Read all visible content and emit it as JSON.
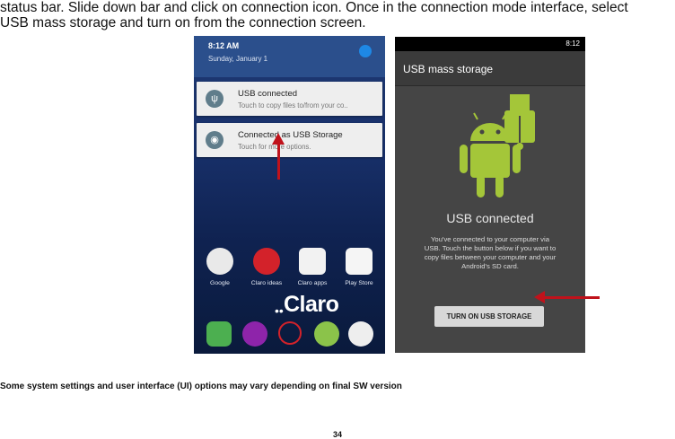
{
  "instructions": {
    "line1": "status bar. Slide down bar and click on connection icon. Once in the connection mode interface, select",
    "line2": "USB mass storage and turn on from the connection screen."
  },
  "left_screen": {
    "time": "8:12 AM",
    "date": "Sunday, January 1",
    "notifications": [
      {
        "title": "USB connected",
        "subtitle": "Touch to copy files to/from your co..",
        "icon": "usb-icon"
      },
      {
        "title": "Connected as USB Storage",
        "subtitle": "Touch for more options.",
        "icon": "android-icon"
      }
    ],
    "apps": [
      "Google",
      "Claro ideas",
      "Claro apps",
      "Play Store"
    ],
    "brand": "Claro"
  },
  "right_screen": {
    "status_time": "8:12",
    "header": "USB mass storage",
    "title": "USB connected",
    "body_lines": [
      "You've connected to your computer via",
      "USB. Touch the button below if you want to",
      "copy files between your computer and your",
      "Android's SD card."
    ],
    "button_label": "TURN ON USB STORAGE"
  },
  "footnote": "Some system settings and user interface (UI) options may vary depending on final SW version",
  "page_number": "34",
  "colors": {
    "arrow": "#c0121b",
    "android_green": "#a4c639",
    "notification_icon": "#607d8b"
  }
}
